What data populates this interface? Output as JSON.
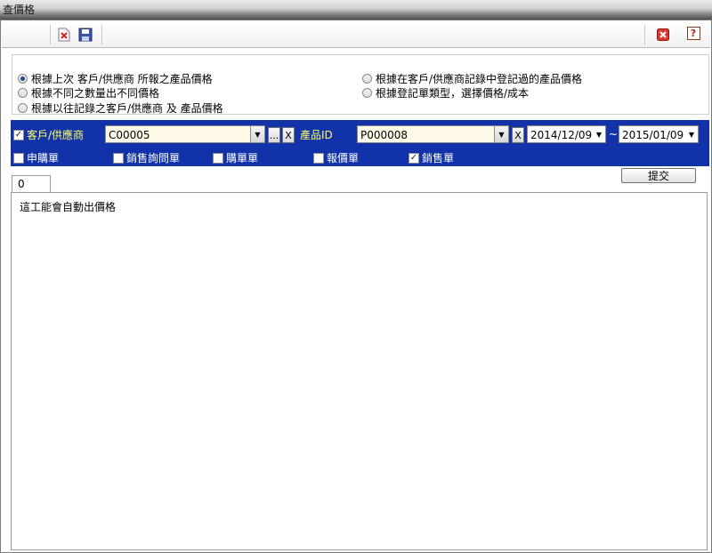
{
  "window": {
    "title": "查價格"
  },
  "toolbar": {
    "delete_icon": "delete-icon",
    "save_icon": "save-icon",
    "close_icon": "close-icon",
    "help_label": "?"
  },
  "options": {
    "items": [
      {
        "label": "根據上次 客戶/供應商 所報之產品價格",
        "selected": true
      },
      {
        "label": "根據在客戶/供應商記錄中登記過的產品價格",
        "selected": false
      },
      {
        "label": "根據不同之數量出不同價格",
        "selected": false
      },
      {
        "label": "根據登記單類型，選擇價格/成本",
        "selected": false
      },
      {
        "label": "根據以往記錄之客戶/供應商 及 產品價格",
        "selected": false
      }
    ]
  },
  "filter": {
    "customer_label": "客戶/供應商",
    "customer_checked": true,
    "customer_value": "C00005",
    "ellipsis_label": "...",
    "clear_label": "X",
    "product_label": "產品ID",
    "product_value": "P000008",
    "date_from": "2014/12/09",
    "date_sep": "~",
    "date_to": "2015/01/09",
    "doc_types": [
      {
        "label": "申購單",
        "checked": false
      },
      {
        "label": "銷售詢問單",
        "checked": false
      },
      {
        "label": "購單單",
        "checked": false
      },
      {
        "label": "報價單",
        "checked": false
      },
      {
        "label": "銷售單",
        "checked": true
      }
    ],
    "submit_label": "提交"
  },
  "tabs": [
    {
      "label": "0"
    }
  ],
  "content": {
    "text": "這工能會自動出價格"
  },
  "colors": {
    "filter_bg": "#1132a8",
    "label_yellow": "#ffff66"
  }
}
